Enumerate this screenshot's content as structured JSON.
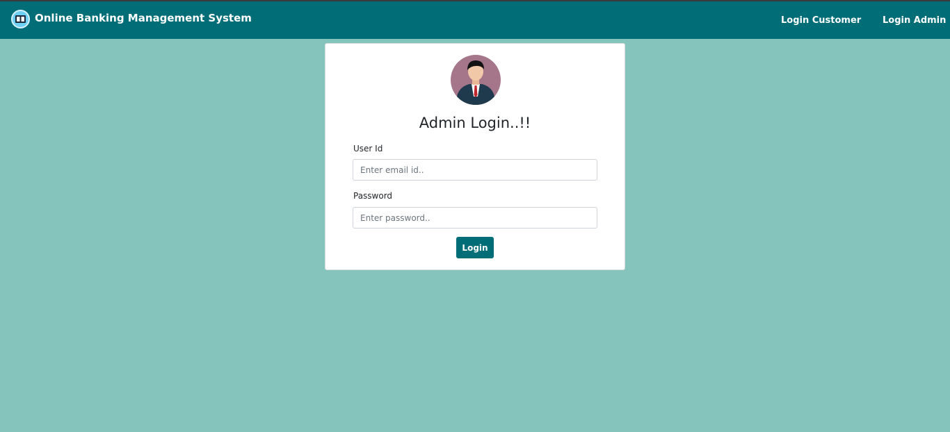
{
  "navbar": {
    "brand_icon": "bank-logo-icon",
    "title": "Online Banking Management System",
    "links": [
      {
        "label": "Login Customer"
      },
      {
        "label": "Login Admin"
      }
    ],
    "background": "#006d77"
  },
  "page": {
    "background": "#85c3bd"
  },
  "login_card": {
    "avatar_icon": "admin-avatar-icon",
    "title": "Admin Login..!!",
    "user_id": {
      "label": "User Id",
      "value": "",
      "placeholder": "Enter email id.."
    },
    "password": {
      "label": "Password",
      "value": "",
      "placeholder": "Enter password.."
    },
    "submit_label": "Login",
    "button_color": "#006d77"
  }
}
